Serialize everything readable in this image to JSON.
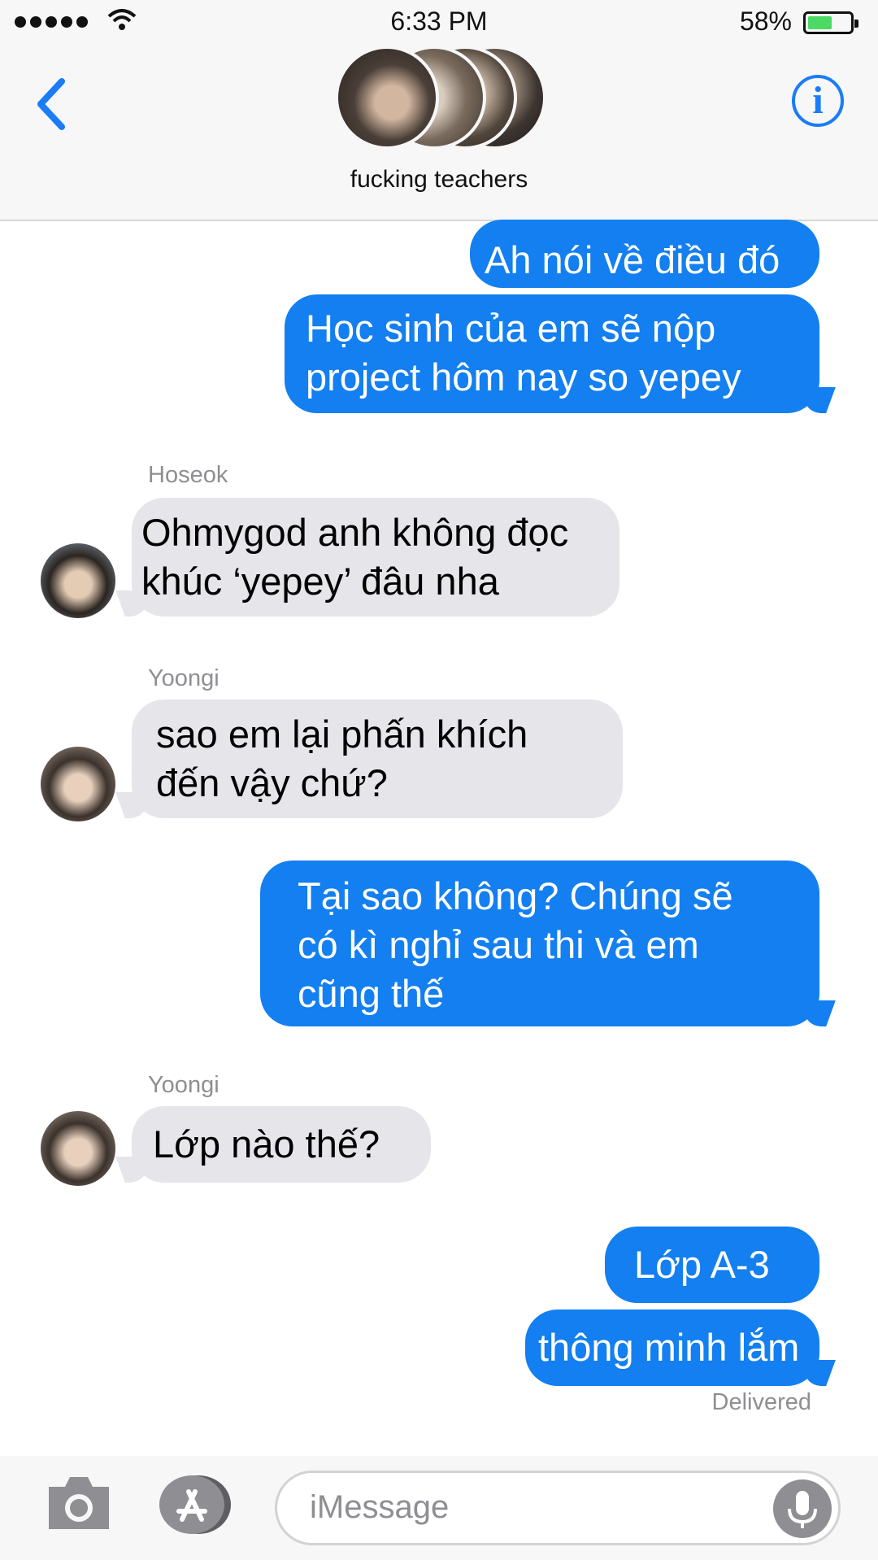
{
  "status_bar": {
    "time": "6:33 PM",
    "battery_percent": "58%",
    "battery_level": 0.58,
    "signal_bars": 5
  },
  "header": {
    "group_name": "fucking teachers",
    "back_icon": "chevron-left-icon",
    "info_icon": "info-icon"
  },
  "messages": [
    {
      "direction": "outgoing",
      "lines": [
        "Ah nói về điều đó"
      ]
    },
    {
      "direction": "outgoing",
      "lines": [
        "Học sinh của em sẽ nộp",
        "project hôm nay so yepey"
      ]
    },
    {
      "direction": "incoming",
      "sender": "Hoseok",
      "lines": [
        "Ohmygod anh không đọc",
        "khúc ‘yepey’ đâu nha"
      ]
    },
    {
      "direction": "incoming",
      "sender": "Yoongi",
      "lines": [
        "sao em lại phấn khích",
        "đến vậy chứ?"
      ]
    },
    {
      "direction": "outgoing",
      "lines": [
        "Tại sao không? Chúng sẽ",
        "có kì nghỉ sau thi và em",
        "cũng thế"
      ]
    },
    {
      "direction": "incoming",
      "sender": "Yoongi",
      "lines": [
        "Lớp nào thế?"
      ]
    },
    {
      "direction": "outgoing",
      "lines": [
        "Lớp A-3"
      ]
    },
    {
      "direction": "outgoing",
      "lines": [
        "thông minh lắm"
      ]
    }
  ],
  "delivery_status": "Delivered",
  "input_bar": {
    "placeholder": "iMessage",
    "camera_icon": "camera-icon",
    "apps_icon": "app-store-icon",
    "mic_icon": "microphone-icon"
  },
  "colors": {
    "outgoing_bubble": "#137ff0",
    "incoming_bubble": "#e5e5ea",
    "accent": "#1a7cf7",
    "secondary_text": "#8e8e93"
  }
}
